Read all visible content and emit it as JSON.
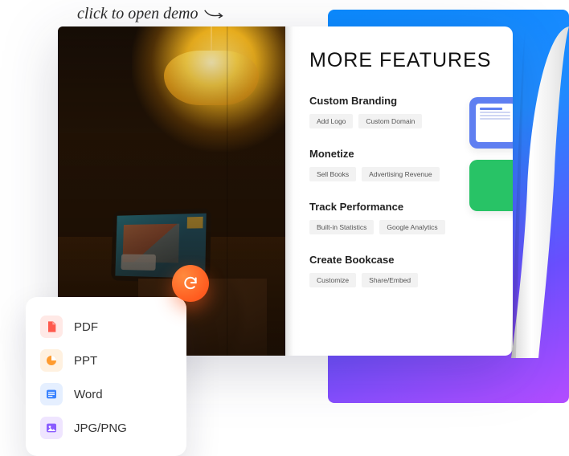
{
  "hint_text": "click to open demo",
  "action_button_name": "refresh-button",
  "page": {
    "title": "MORE FEATURES",
    "sections": [
      {
        "heading": "Custom Branding",
        "pills": [
          "Add Logo",
          "Custom Domain"
        ]
      },
      {
        "heading": "Monetize",
        "pills": [
          "Sell Books",
          "Advertising Revenue"
        ]
      },
      {
        "heading": "Track Performance",
        "pills": [
          "Built-in Statistics",
          "Google Analytics"
        ]
      },
      {
        "heading": "Create Bookcase",
        "pills": [
          "Customize",
          "Share/Embed"
        ]
      }
    ]
  },
  "formats": [
    {
      "label": "PDF",
      "icon": "pdf-icon",
      "color_class": "ic-pdf"
    },
    {
      "label": "PPT",
      "icon": "ppt-icon",
      "color_class": "ic-ppt"
    },
    {
      "label": "Word",
      "icon": "word-icon",
      "color_class": "ic-word"
    },
    {
      "label": "JPG/PNG",
      "icon": "image-icon",
      "color_class": "ic-img"
    }
  ],
  "colors": {
    "action": "#ff5b1f",
    "gradient_start": "#0a8aff",
    "gradient_end": "#b34cff"
  }
}
